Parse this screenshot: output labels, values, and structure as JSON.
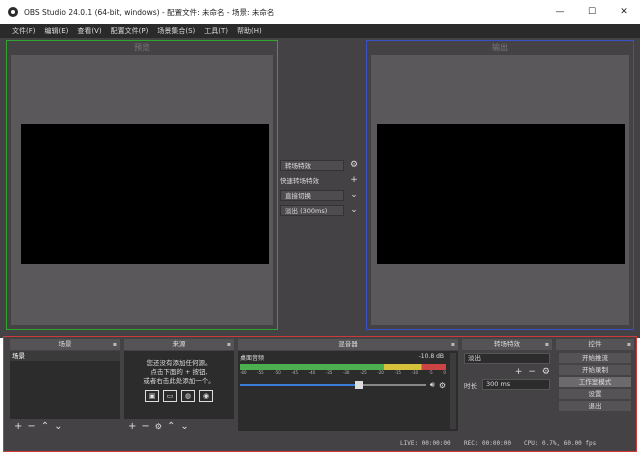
{
  "window": {
    "title": "OBS Studio 24.0.1 (64-bit, windows) - 配置文件: 未命名 - 场景: 未命名",
    "controls": [
      "—",
      "☐",
      "✕"
    ]
  },
  "menu": [
    "文件(F)",
    "编辑(E)",
    "查看(V)",
    "配置文件(P)",
    "场景集合(S)",
    "工具(T)",
    "帮助(H)"
  ],
  "preview": {
    "label": "预览"
  },
  "program": {
    "label": "输出"
  },
  "transition_panel": {
    "transition_btn": "转场特效",
    "quick_label": "快速转场特效",
    "cut_btn": "直接切换",
    "fade_btn": "淡出 (300ms)"
  },
  "docks": {
    "scenes": {
      "title": "场景",
      "items": [
        "场景"
      ]
    },
    "sources": {
      "title": "来源",
      "hint_line1": "您还没有添加任何源。",
      "hint_line2": "点击下面的 + 按钮,",
      "hint_line3": "或者右击此处添加一个。"
    },
    "mixer": {
      "title": "混音器",
      "track_name": "桌面音频",
      "track_db": "-10.8 dB",
      "ticks": [
        "-60",
        "-55",
        "-50",
        "-45",
        "-40",
        "-35",
        "-30",
        "-25",
        "-20",
        "-15",
        "-10",
        "-5",
        "0"
      ]
    },
    "transitions": {
      "title": "转场特效",
      "selected": "淡出",
      "duration_label": "时长",
      "duration_value": "300 ms"
    },
    "controls": {
      "title": "控件",
      "buttons": [
        "开始推流",
        "开始录制",
        "工作室模式",
        "设置",
        "退出"
      ]
    }
  },
  "status": {
    "live": "LIVE: 00:00:00",
    "rec": "REC: 00:00:00",
    "cpu": "CPU: 0.7%, 60.00 fps"
  }
}
